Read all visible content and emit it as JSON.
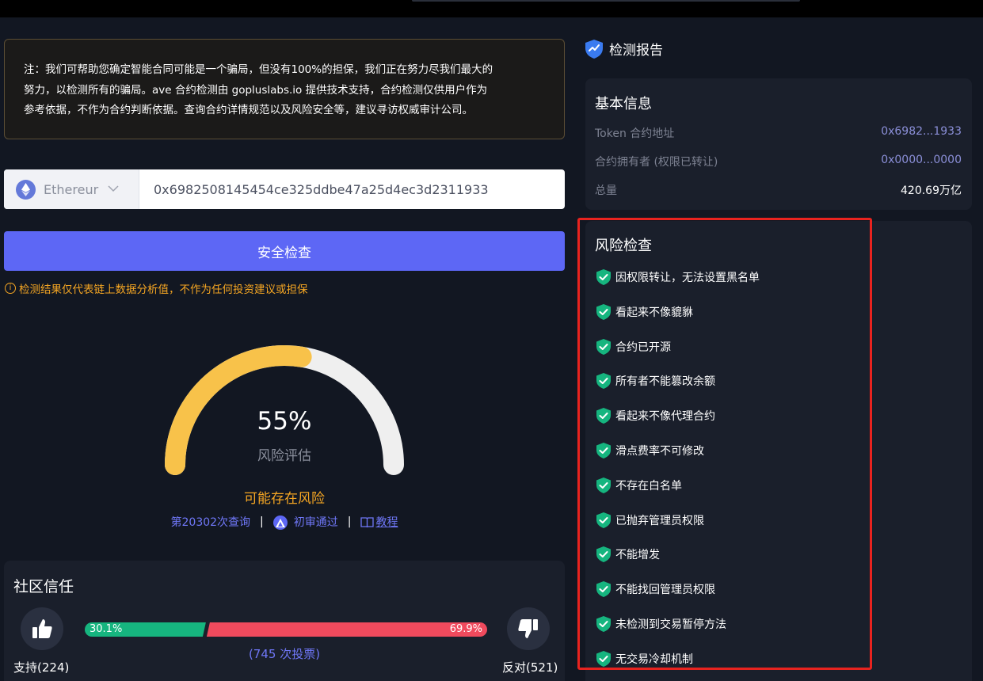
{
  "notice": {
    "line1": "注：我们可帮助您确定智能合同可能是一个骗局，但没有100%的担保，我们正在努力尽我们最大的",
    "line2": "努力，以检测所有的骗局。ave 合约检测由 gopluslabs.io 提供技术支持，合约检测仅供用户作为",
    "line3": "参考依据，不作为合约判断依据。查询合约详情规范以及风险安全等，建议寻访权威审计公司。"
  },
  "chain": {
    "name": "Ethereur",
    "icon": "ethereum-icon"
  },
  "address_input": {
    "value": "0x6982508145454ce325ddbe47a25d4ec3d2311933"
  },
  "check_button": {
    "label": "安全检查"
  },
  "disclaimer": {
    "icon": "info-icon",
    "text": "检测结果仅代表链上数据分析值，不作为任何投资建议或担保"
  },
  "gauge": {
    "percent": 55,
    "percent_text": "55%",
    "label": "风险评估",
    "status": "可能存在风险",
    "colors": {
      "fill": "#f8c24a",
      "track": "#efefef"
    }
  },
  "meta": {
    "query_count": "第20302次查询",
    "audit": "初审通过",
    "tutorial": "教程",
    "sep": "|"
  },
  "community": {
    "title": "社区信任",
    "support_label": "支持(224)",
    "oppose_label": "反对(521)",
    "support_pct": 30.1,
    "support_pct_text": "30.1%",
    "oppose_pct_text": "69.9%",
    "total_votes": "(745 次投票)",
    "colors": {
      "support": "#16b57f",
      "oppose": "#f04a5d"
    }
  },
  "report": {
    "title": "检测报告",
    "icon": "shield-chart-icon"
  },
  "basic_info": {
    "title": "基本信息",
    "rows": [
      {
        "key": "Token 合约地址",
        "value": "0x6982...1933"
      },
      {
        "key": "合约拥有者 (权限已转让)",
        "value": "0x0000...0000"
      },
      {
        "key": "总量",
        "value": "420.69万亿"
      }
    ]
  },
  "risk_check": {
    "title": "风险检查",
    "items": [
      "因权限转让，无法设置黑名单",
      "看起来不像貔貅",
      "合约已开源",
      "所有者不能篡改余额",
      "看起来不像代理合约",
      "滑点费率不可修改",
      "不存在白名单",
      "已抛弃管理员权限",
      "不能增发",
      "不能找回管理员权限",
      "未检测到交易暂停方法",
      "无交易冷却机制"
    ],
    "check_color": "#16b57f"
  }
}
